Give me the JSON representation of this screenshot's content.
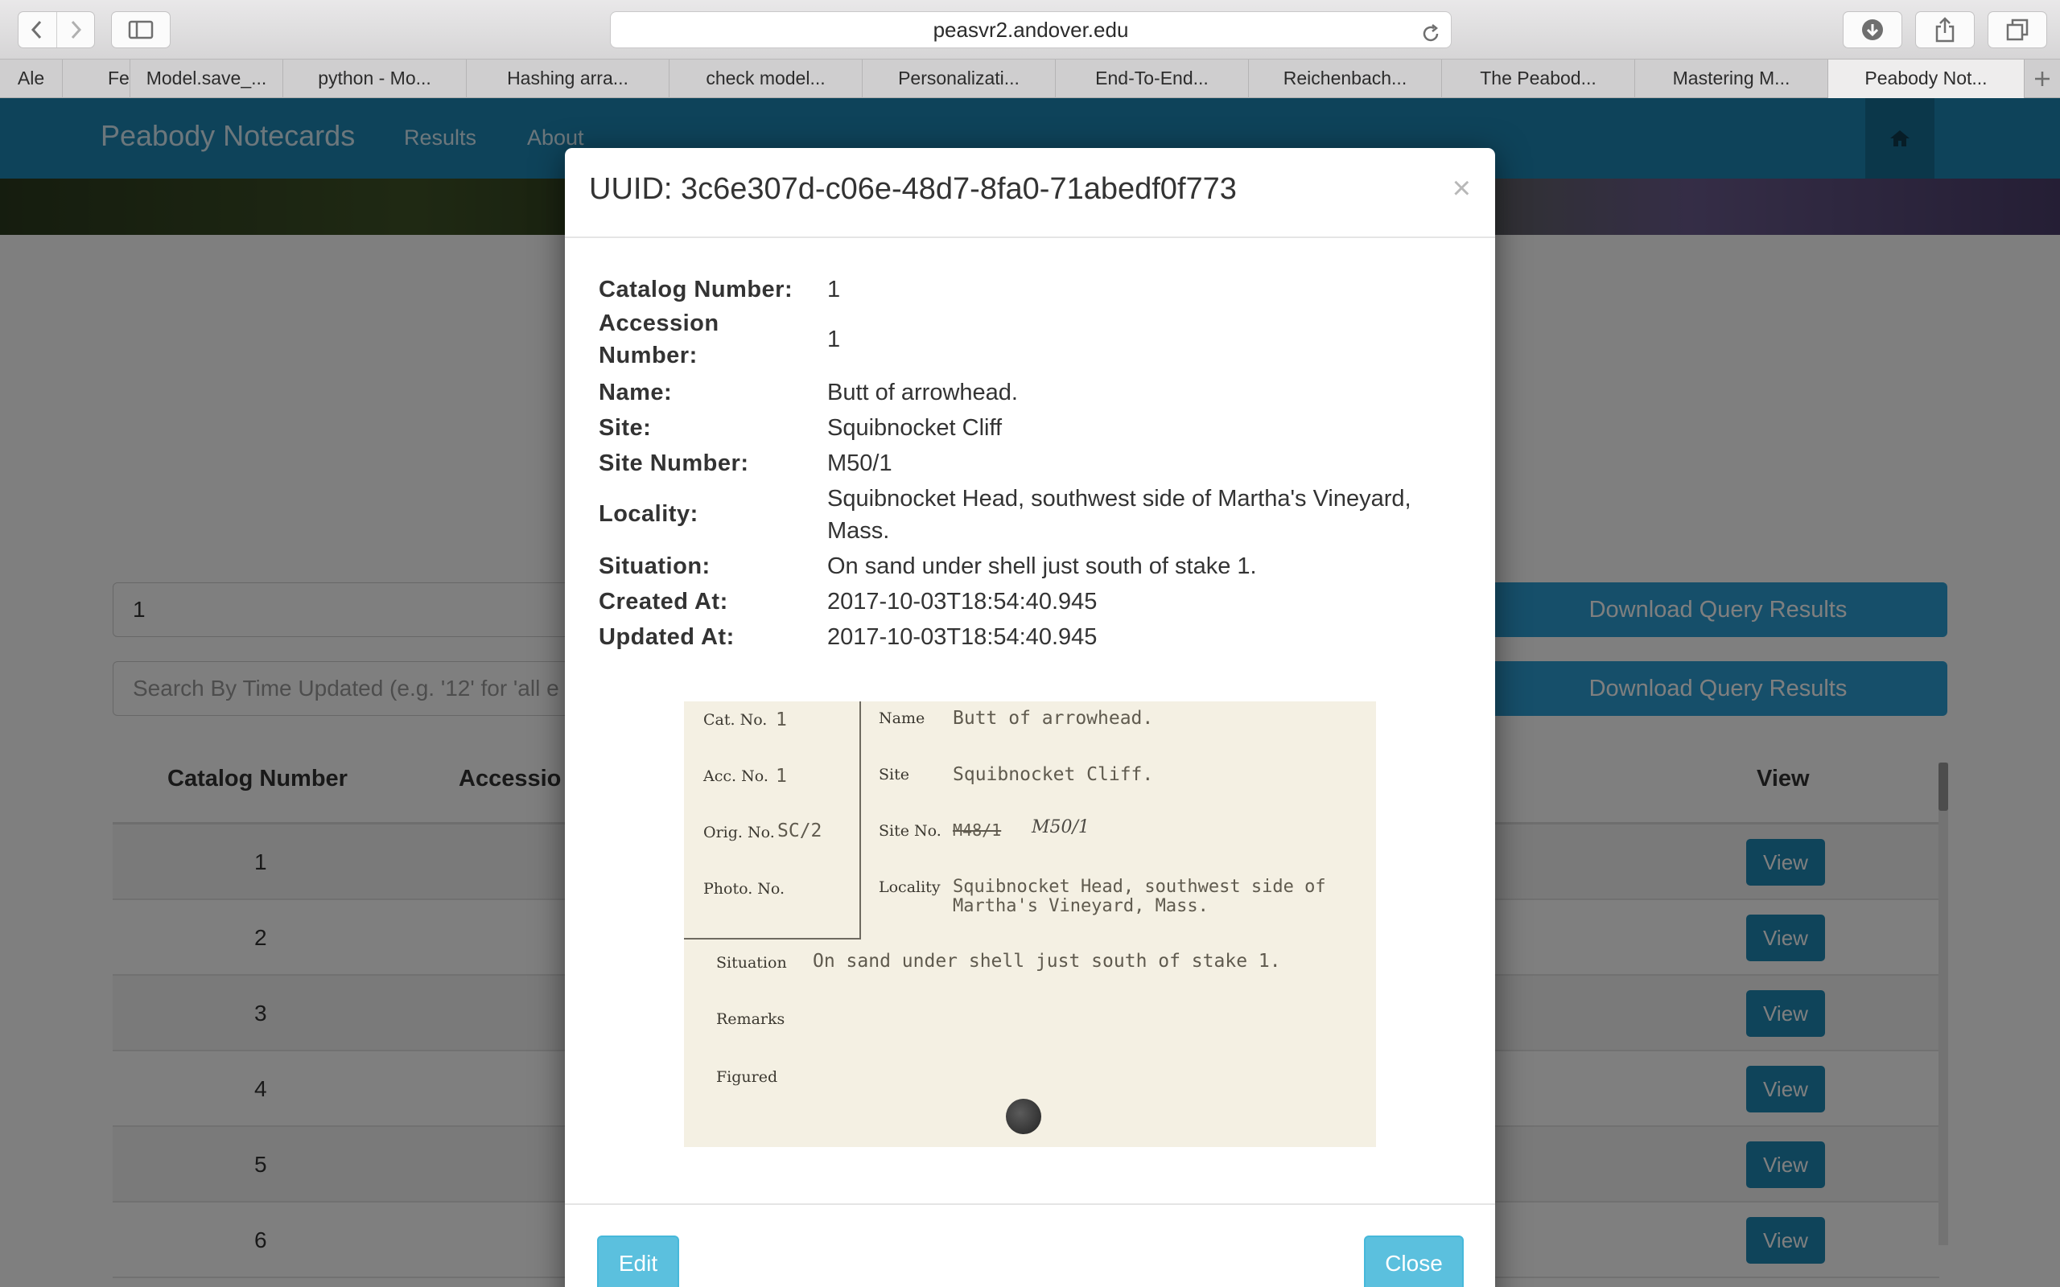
{
  "browser": {
    "address": "peasvr2.andover.edu",
    "tabs": [
      {
        "label": "Ale"
      },
      {
        "label": "Fe"
      },
      {
        "label": "Model.save_..."
      },
      {
        "label": "python - Mo..."
      },
      {
        "label": "Hashing arra..."
      },
      {
        "label": "check model..."
      },
      {
        "label": "Personalizati..."
      },
      {
        "label": "End-To-End..."
      },
      {
        "label": "Reichenbach..."
      },
      {
        "label": "The Peabod..."
      },
      {
        "label": "Mastering M..."
      },
      {
        "label": "Peabody Not..."
      }
    ]
  },
  "navbar": {
    "brand": "Peabody Notecards",
    "links": [
      "Results",
      "About"
    ]
  },
  "search": {
    "catalog_value": "1",
    "time_placeholder": "Search By Time Updated (e.g. '12' for 'all e",
    "download_label_1": "Download Query Results",
    "download_label_2": "Download Query Results"
  },
  "table": {
    "headers": {
      "catalog": "Catalog Number",
      "accession": "Accessio",
      "view": "View"
    },
    "rows": [
      "1",
      "2",
      "3",
      "4",
      "5",
      "6"
    ],
    "view_label": "View"
  },
  "modal": {
    "title": "UUID: 3c6e307d-c06e-48d7-8fa0-71abedf0f773",
    "close_x": "×",
    "fields": {
      "catalog_number": {
        "label": "Catalog Number:",
        "value": "1"
      },
      "accession_number": {
        "label_line1": "Accession",
        "label_line2": "Number:",
        "value": "1"
      },
      "name": {
        "label": "Name:",
        "value": "Butt of arrowhead."
      },
      "site": {
        "label": "Site:",
        "value": "Squibnocket Cliff"
      },
      "site_number": {
        "label": "Site Number:",
        "value": "M50/1"
      },
      "locality": {
        "label": "Locality:",
        "value_line1": "Squibnocket Head, southwest side of Martha's Vineyard,",
        "value_line2": "Mass."
      },
      "situation": {
        "label": "Situation:",
        "value": "On sand under shell just south of stake 1."
      },
      "created_at": {
        "label": "Created At:",
        "value": "2017-10-03T18:54:40.945"
      },
      "updated_at": {
        "label": "Updated At:",
        "value": "2017-10-03T18:54:40.945"
      }
    },
    "notecard": {
      "cat_no_label": "Cat. No.",
      "cat_no": "1",
      "acc_no_label": "Acc. No.",
      "acc_no": "1",
      "orig_no_label": "Orig. No.",
      "orig_no": "SC/2",
      "photo_no_label": "Photo. No.",
      "name_label": "Name",
      "name": "Butt of arrowhead.",
      "site_label": "Site",
      "site": "Squibnocket Cliff.",
      "site_no_label": "Site No.",
      "site_no_struck": "M48/1",
      "site_no": "M50/1",
      "locality_label": "Locality",
      "locality_line1": "Squibnocket Head, southwest side of",
      "locality_line2": "Martha's Vineyard, Mass.",
      "situation_label": "Situation",
      "situation": "On sand under shell just south of stake 1.",
      "remarks_label": "Remarks",
      "figured_label": "Figured"
    },
    "edit_label": "Edit",
    "close_label": "Close"
  }
}
